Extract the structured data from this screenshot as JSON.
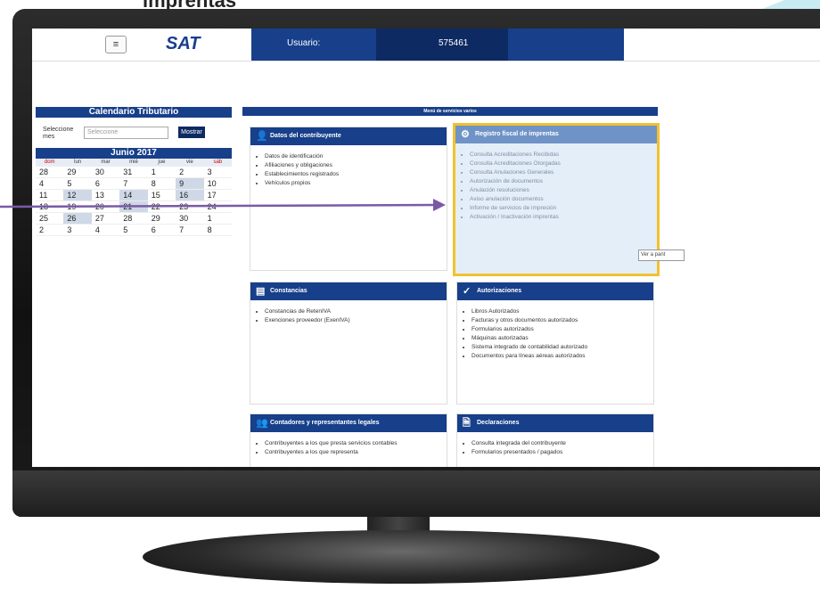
{
  "slide_title": "imprentas",
  "app": {
    "logo": "SAT",
    "menu_icon": "≡"
  },
  "user": {
    "label": "Usuario:",
    "id": "575461"
  },
  "calendar": {
    "title": "Calendario Tributario",
    "select_label": "Seleccione mes",
    "select_placeholder": "Seleccione",
    "show_button": "Mostrar",
    "month": "Junio 2017",
    "weekdays": [
      "dom",
      "lun",
      "mar",
      "mié",
      "jue",
      "vie",
      "sáb"
    ],
    "weeks": [
      [
        "28",
        "29",
        "30",
        "31",
        "1",
        "2",
        "3"
      ],
      [
        "4",
        "5",
        "6",
        "7",
        "8",
        "9",
        "10"
      ],
      [
        "11",
        "12",
        "13",
        "14",
        "15",
        "16",
        "17"
      ],
      [
        "18",
        "19",
        "20",
        "21",
        "22",
        "23",
        "24"
      ],
      [
        "25",
        "26",
        "27",
        "28",
        "29",
        "30",
        "1"
      ],
      [
        "2",
        "3",
        "4",
        "5",
        "6",
        "7",
        "8"
      ]
    ]
  },
  "services_header": "Menú de servicios varios",
  "cards": {
    "datos": {
      "title": "Datos del contribuyente",
      "items": [
        "Datos de identificación",
        "Afiliaciones y obligaciones",
        "Establecimientos registrados",
        "Vehículos propios"
      ]
    },
    "registro": {
      "title": "Registro fiscal de imprentas",
      "items": [
        "Consulta Acreditaciones Recibidas",
        "Consulta Acreditaciones Otorgadas",
        "Consulta Anulaciones Generales",
        "Autorización de documentos",
        "Anulación resoluciones",
        "Aviso anulación documentos",
        "Informe de servicios de impresión",
        "Activación / Inactivación imprentas"
      ]
    },
    "constancias": {
      "title": "Constancias",
      "items": [
        "Constancias de RetenIVA",
        "Exenciones proveedor (ExenIVA)"
      ]
    },
    "autorizaciones": {
      "title": "Autorizaciones",
      "items": [
        "Libros Autorizados",
        "Facturas y otros documentos autorizados",
        "Formularios autorizados",
        "Máquinas autorizadas",
        "Sistema integrado de contabilidad autorizado",
        "Documentos para líneas aéreas autorizados"
      ]
    },
    "contadores": {
      "title": "Contadores y representantes legales",
      "items": [
        "Contribuyentes a los que presta servicios contables",
        "Contribuyentes a los que representa"
      ]
    },
    "declaraciones": {
      "title": "Declaraciones",
      "items": [
        "Consulta integrada del contribuyente",
        "Formularios presentados / pagados"
      ]
    }
  },
  "tooltip": "Ver a pant"
}
